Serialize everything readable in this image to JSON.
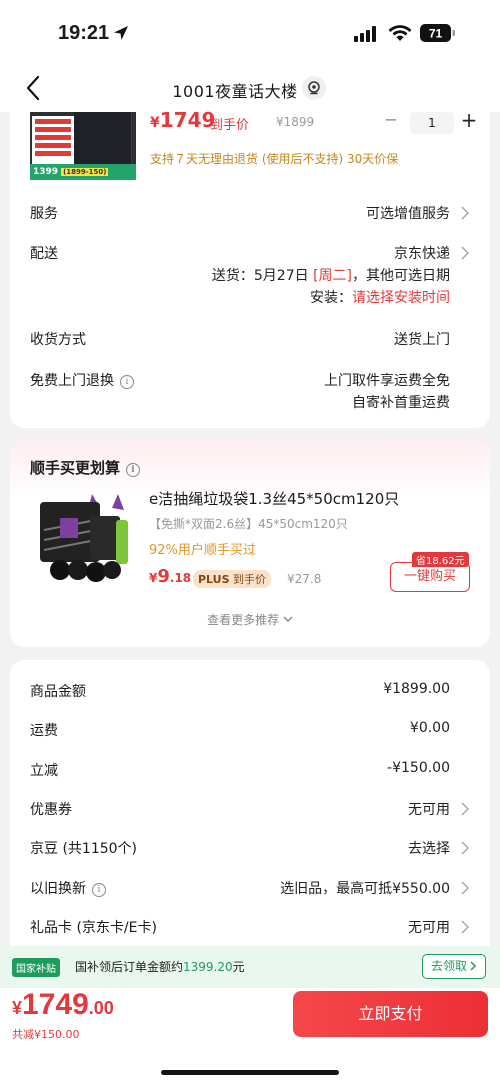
{
  "status": {
    "time": "19:21",
    "battery": "71"
  },
  "nav": {
    "title": "1001夜童话大楼"
  },
  "product": {
    "image_bar_text": "1399",
    "image_bar_badge": "(1899-150)",
    "price_currency": "¥",
    "price": "1749",
    "price_label": "到手价",
    "original_price": "¥1899",
    "quantity": "1",
    "minus": "−",
    "plus": "+",
    "return_note": "支持７天无理由退货 (使用后不支持)  30天价保"
  },
  "details": {
    "service_label": "服务",
    "service_value": "可选增值服务",
    "delivery_label": "配送",
    "delivery_value": "京东快递",
    "delivery_date_prefix": "送货：5月27日 ",
    "delivery_date_weekday": "[周二]",
    "delivery_date_suffix": "，其他可选日期",
    "install_prefix": "安装：",
    "install_value": "请选择安装时间",
    "receive_label": "收货方式",
    "receive_value": "送货上门",
    "free_return_label": "免费上门退换",
    "free_return_line1": "上门取件享运费全免",
    "free_return_line2": "自寄补首重运费",
    "info_glyph": "i"
  },
  "addon": {
    "title": "顺手买更划算",
    "name": "e洁抽绳垃圾袋1.3丝45*50cm120只",
    "spec": "【免撕*双面2.6丝】45*50cm120只",
    "popularity": "92%用户顺手买过",
    "price_currency": "¥",
    "price_int": "9",
    "price_dec": ".18",
    "plus_label": "PLUS",
    "plus_suffix": "到手价",
    "original_price": "¥27.8",
    "save_tag": "省18.62元",
    "buy_button": "一键购买",
    "more": "查看更多推荐"
  },
  "summary": {
    "rows": [
      {
        "label": "商品金额",
        "value": "¥1899.00"
      },
      {
        "label": "运费",
        "value": "¥0.00"
      },
      {
        "label": "立减",
        "value": "-¥150.00"
      },
      {
        "label": "优惠券",
        "value": "无可用"
      },
      {
        "label": "京豆 (共1150个)",
        "value": "去选择"
      },
      {
        "label": "以旧换新",
        "value": "选旧品，最高可抵¥550.00"
      },
      {
        "label": "礼品卡 (京东卡/E卡)",
        "value": "无可用"
      }
    ]
  },
  "subsidy": {
    "badge": "国家补贴",
    "text_prefix": "国补领后订单金额约",
    "amount": "1399.20",
    "text_suffix": "元",
    "button": "去领取"
  },
  "footer": {
    "currency": "¥",
    "total_int": "1749",
    "total_dec": ".00",
    "discount": "共减¥150.00",
    "pay_button": "立即支付"
  },
  "colors": {
    "accent": "#e4393c",
    "green": "#1f9c5c",
    "orange": "#c8851c"
  }
}
